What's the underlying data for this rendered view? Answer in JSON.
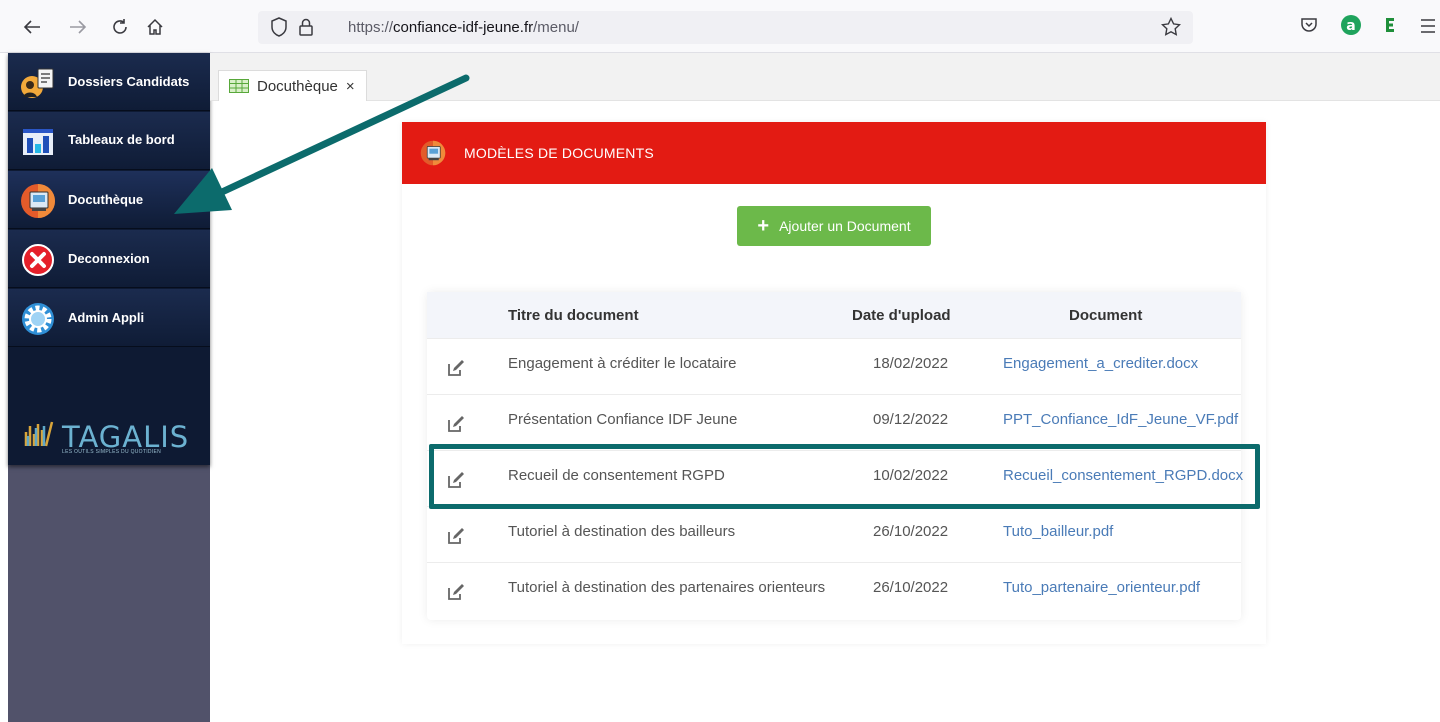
{
  "browser": {
    "url_prefix": "https://",
    "url_domain": "confiance-idf-jeune.fr",
    "url_path": "/menu/"
  },
  "sidebar": {
    "items": [
      {
        "label": "Dossiers Candidats",
        "icon": "candidate-folder-icon"
      },
      {
        "label": "Tableaux de bord",
        "icon": "dashboard-chart-icon"
      },
      {
        "label": "Docuthèque",
        "icon": "document-library-icon"
      },
      {
        "label": "Deconnexion",
        "icon": "logout-x-icon"
      },
      {
        "label": "Admin Appli",
        "icon": "gear-icon"
      }
    ],
    "logo_word": "TAGALIS",
    "logo_tagline": "LES OUTILS SIMPLES DU QUOTIDIEN"
  },
  "tab": {
    "label": "Docuthèque",
    "close": "×"
  },
  "panel": {
    "title": "MODÈLES DE DOCUMENTS",
    "add_button": "Ajouter un Document",
    "add_icon": "+",
    "columns": [
      "Titre du document",
      "Date d'upload",
      "Document"
    ],
    "rows": [
      {
        "title": "Engagement à créditer le locataire",
        "date": "18/02/2022",
        "file": "Engagement_a_crediter.docx"
      },
      {
        "title": "Présentation Confiance IDF Jeune",
        "date": "09/12/2022",
        "file": "PPT_Confiance_IdF_Jeune_VF.pdf"
      },
      {
        "title": "Recueil de consentement RGPD",
        "date": "10/02/2022",
        "file": "Recueil_consentement_RGPD.docx"
      },
      {
        "title": "Tutoriel à destination des bailleurs",
        "date": "26/10/2022",
        "file": "Tuto_bailleur.pdf"
      },
      {
        "title": "Tutoriel à destination des partenaires orienteurs",
        "date": "26/10/2022",
        "file": "Tuto_partenaire_orienteur.pdf"
      }
    ]
  },
  "colors": {
    "header_red": "#e31b13",
    "add_green": "#6cb94a",
    "annotation_teal": "#0c6b6c",
    "sidebar_navy": "#0e1a33",
    "link_blue": "#4a7bb7"
  }
}
